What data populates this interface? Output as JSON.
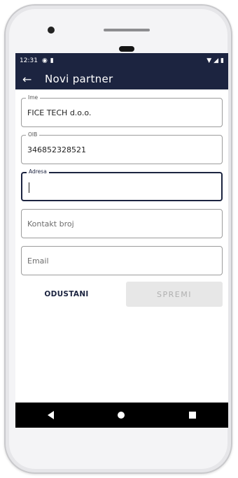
{
  "status_bar": {
    "time": "12:31"
  },
  "app_bar": {
    "title": "Novi partner"
  },
  "form": {
    "name": {
      "label": "Ime",
      "value": "FICE TECH d.o.o."
    },
    "oib": {
      "label": "OIB",
      "value": "346852328521"
    },
    "address": {
      "label": "Adresa",
      "value": ""
    },
    "contact": {
      "placeholder": "Kontakt broj"
    },
    "email": {
      "placeholder": "Email"
    }
  },
  "actions": {
    "cancel_label": "ODUSTANI",
    "save_label": "SPREMI"
  },
  "colors": {
    "primary": "#1c2440",
    "disabled_bg": "#e7e7e7",
    "disabled_text": "#b0b0b0"
  }
}
